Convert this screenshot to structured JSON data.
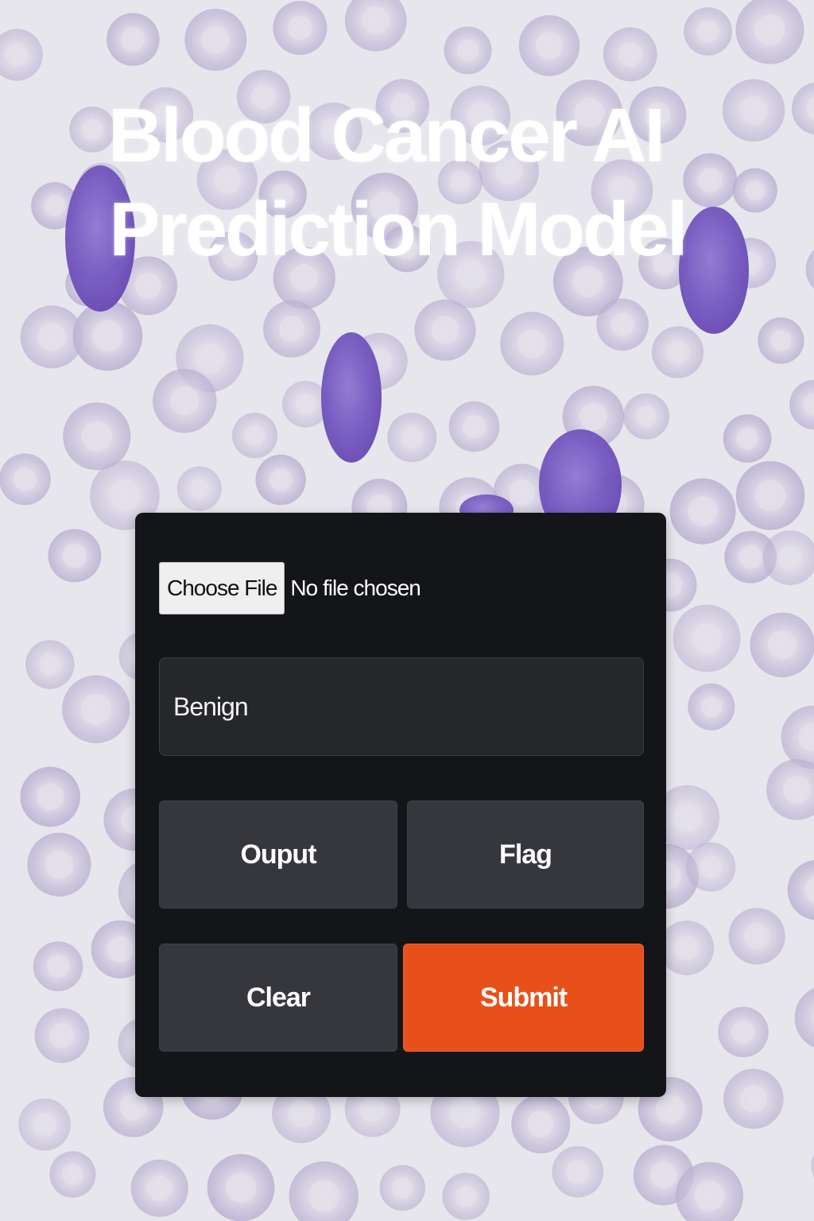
{
  "page": {
    "title_line1": "Blood Cancer AI",
    "title_line2": "Prediction Model"
  },
  "form": {
    "choose_file_label": "Choose File",
    "file_status": "No file chosen",
    "result_value": "Benign"
  },
  "buttons": {
    "output_label": "Ouput",
    "flag_label": "Flag",
    "clear_label": "Clear",
    "submit_label": "Submit"
  },
  "colors": {
    "panel_background": "#141518",
    "button_dark": "#36373c",
    "submit_accent": "#e8501a",
    "title_text": "#ffffff",
    "red_cell": "#c4bcd8",
    "blast_cell": "#7a5fc4"
  }
}
